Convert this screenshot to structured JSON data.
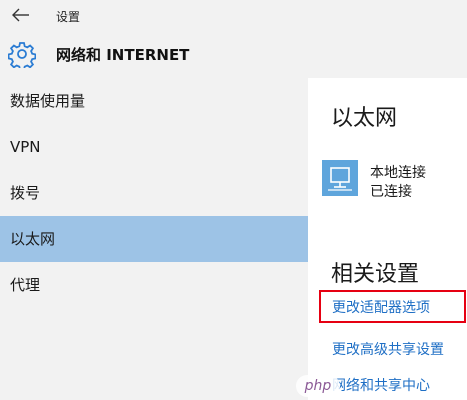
{
  "window": {
    "app_title": "设置"
  },
  "header": {
    "page_title": "网络和 INTERNET"
  },
  "sidebar": {
    "items": [
      {
        "label": "数据使用量",
        "selected": false
      },
      {
        "label": "VPN",
        "selected": false
      },
      {
        "label": "拨号",
        "selected": false
      },
      {
        "label": "以太网",
        "selected": true
      },
      {
        "label": "代理",
        "selected": false
      }
    ]
  },
  "main": {
    "ethernet_title": "以太网",
    "connection": {
      "name": "本地连接",
      "status": "已连接",
      "icon": "ethernet-monitor-icon"
    },
    "related_title": "相关设置",
    "links": [
      {
        "label": "更改适配器选项",
        "highlighted": true
      },
      {
        "label": "更改高级共享设置",
        "highlighted": false
      },
      {
        "label": "网络和共享中心",
        "highlighted": false
      }
    ]
  },
  "watermark": {
    "text": "php"
  },
  "colors": {
    "selected_bg": "#9dc3e6",
    "link": "#1f6fc5",
    "highlight_border": "#e60012",
    "icon_blue": "#2b7cd3"
  }
}
